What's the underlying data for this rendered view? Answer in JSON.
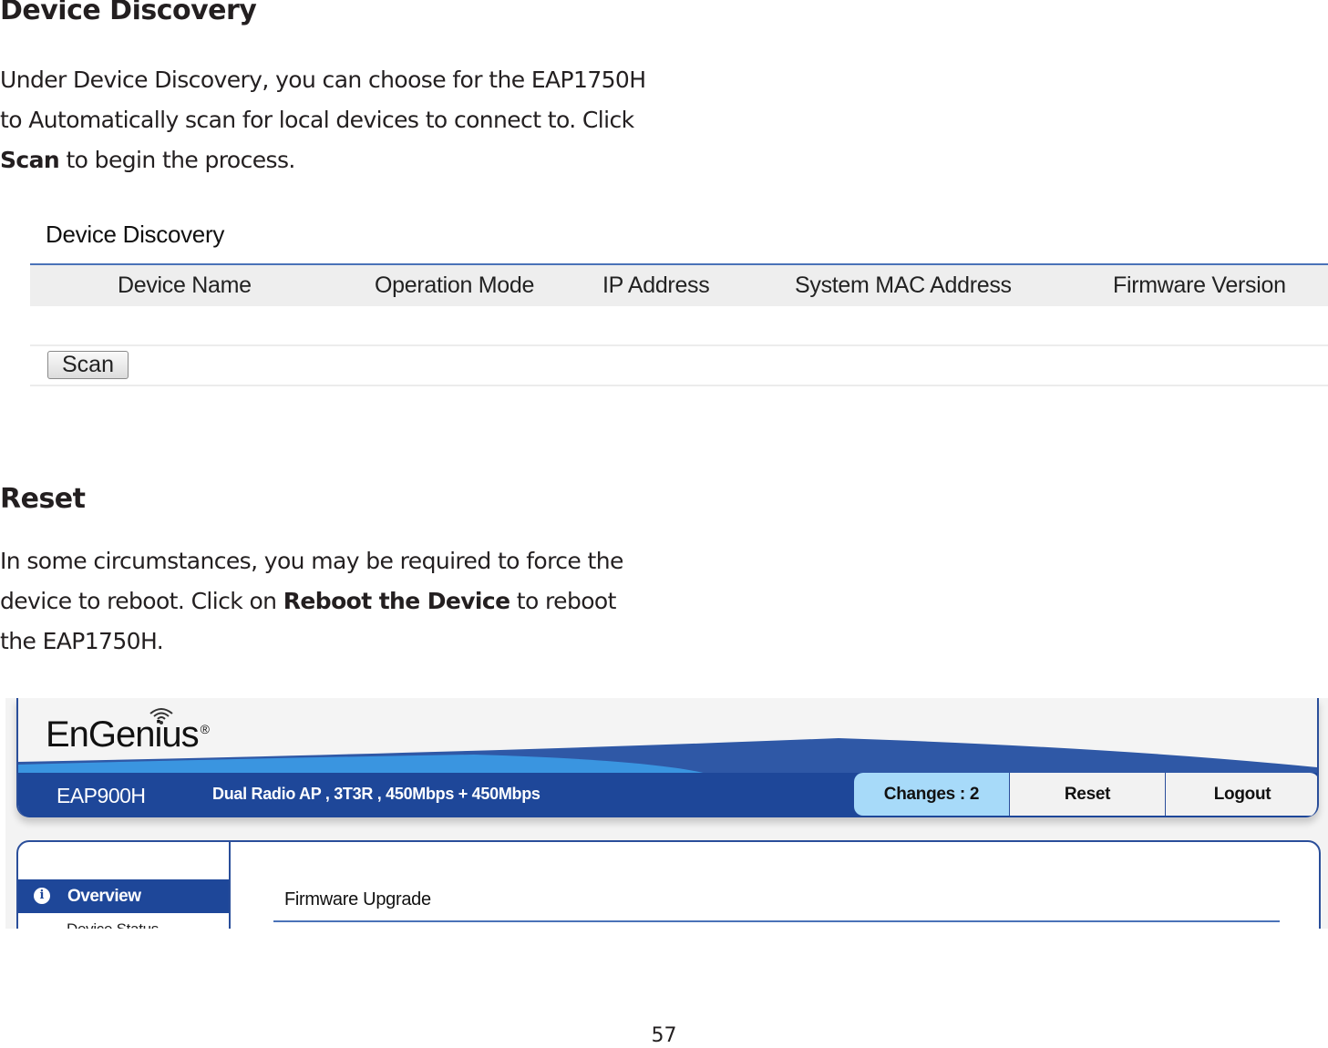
{
  "sections": {
    "device_discovery": {
      "heading": "Device Discovery",
      "para_line1": "Under Device Discovery, you can choose for the EAP1750H",
      "para_line2": "to Automatically scan for local devices to connect to. Click",
      "para_bold": "Scan",
      "para_line3_rest": " to begin the process."
    },
    "reset": {
      "heading": "Reset",
      "para_line1": "In some circumstances, you may be required to force the",
      "para_line2_pre": "device to reboot. Click on ",
      "para_bold": "Reboot the Device",
      "para_line2_post": " to reboot",
      "para_line3": "the EAP1750H."
    }
  },
  "device_discovery_panel": {
    "title": "Device Discovery",
    "columns": [
      "Device Name",
      "Operation Mode",
      "IP Address",
      "System MAC Address",
      "Firmware Version"
    ],
    "rows": [],
    "scan_button": "Scan"
  },
  "engenius_ui": {
    "logo_text": "EnGenius",
    "logo_mark": "®",
    "logo_icon": "wifi-icon",
    "model": "EAP900H",
    "description": "Dual Radio AP , 3T3R , 450Mbps + 450Mbps",
    "buttons": {
      "changes": "Changes : 2",
      "reset": "Reset",
      "logout": "Logout"
    },
    "sidebar": {
      "active_item": "Overview",
      "active_icon": "info-icon",
      "sub_item": "Device Status"
    },
    "content_title": "Firmware Upgrade",
    "colors": {
      "primary_blue": "#1e4799",
      "changes_bg": "#a7daf9",
      "wave_light": "#3a95e0"
    }
  },
  "page_number": "57"
}
